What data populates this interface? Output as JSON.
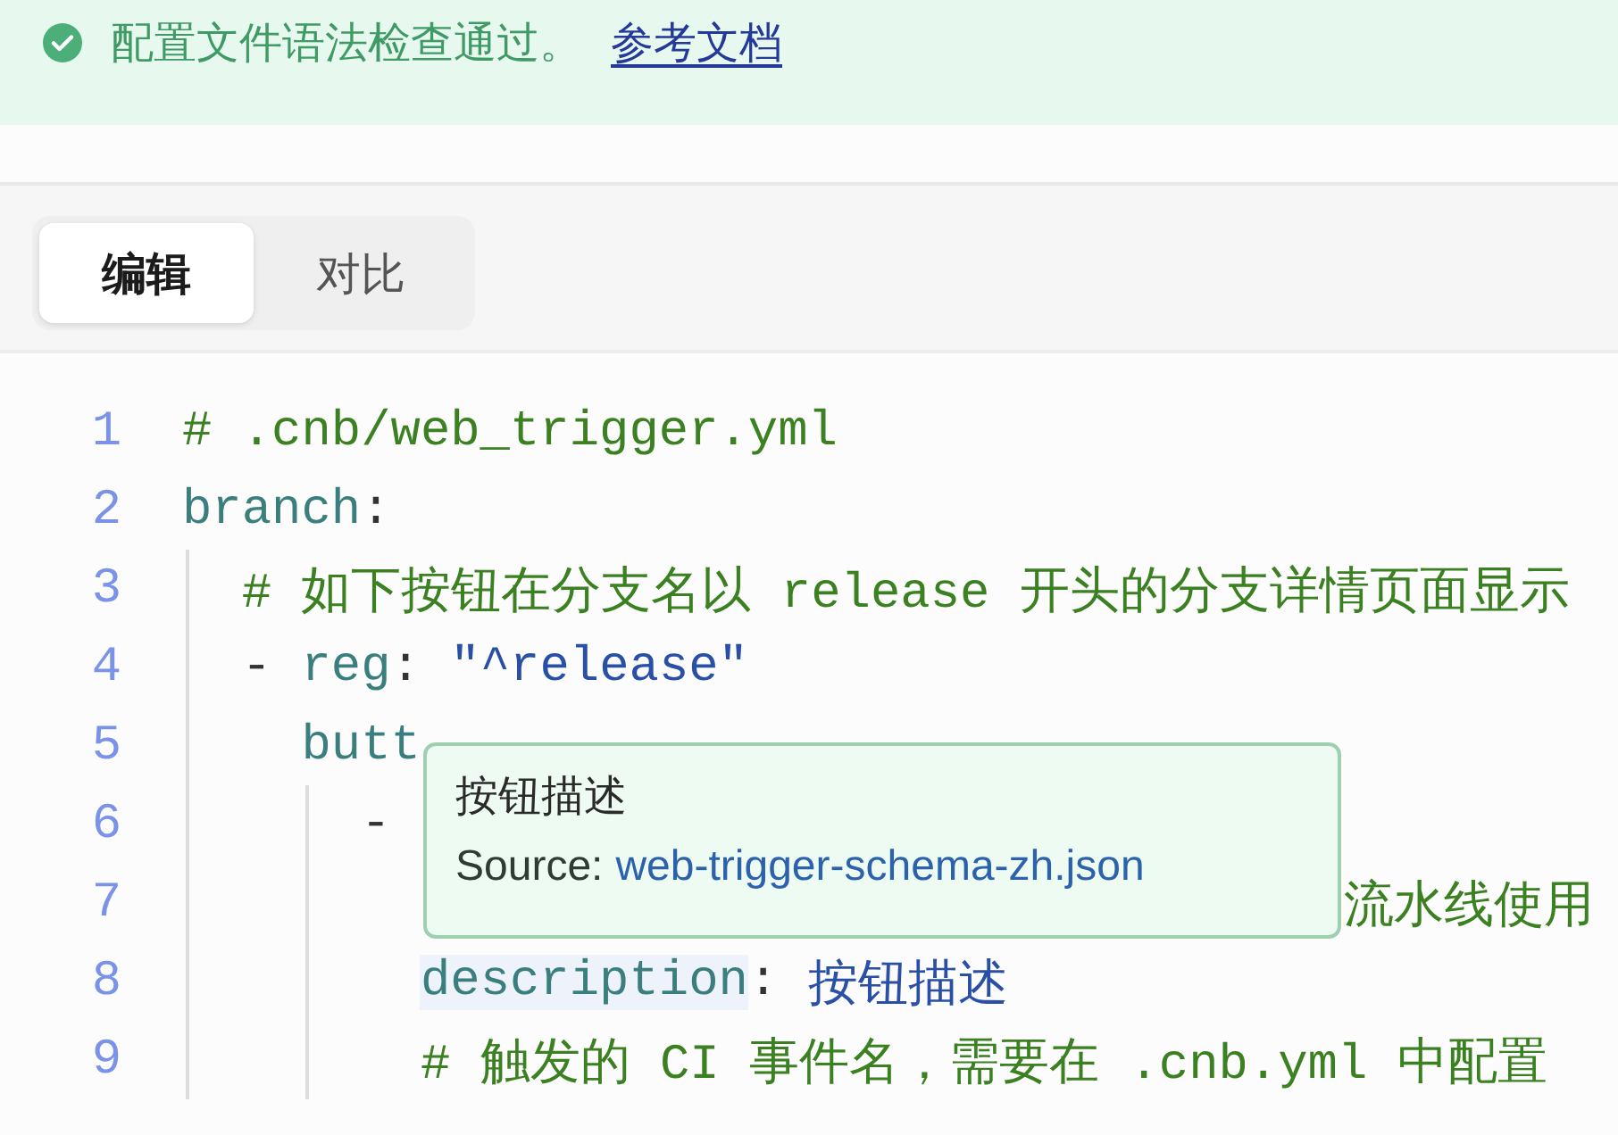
{
  "banner": {
    "message": "配置文件语法检查通过。",
    "link": "参考文档"
  },
  "tabs": [
    {
      "label": "编辑",
      "selected": true
    },
    {
      "label": "对比",
      "selected": false
    }
  ],
  "editor": {
    "lines": [
      {
        "number": "1",
        "tokens": [
          {
            "kind": "comment",
            "text": "# .cnb/web_trigger.yml"
          }
        ]
      },
      {
        "number": "2",
        "tokens": [
          {
            "kind": "key",
            "text": "branch"
          },
          {
            "kind": "punct",
            "text": ":"
          }
        ]
      },
      {
        "number": "3",
        "tokens": [
          {
            "kind": "comment",
            "text": "  # 如下按钮在分支名以 release 开头的分支详情页面显示"
          }
        ]
      },
      {
        "number": "4",
        "tokens": [
          {
            "kind": "punct",
            "text": "  - "
          },
          {
            "kind": "key",
            "text": "reg"
          },
          {
            "kind": "punct",
            "text": ": "
          },
          {
            "kind": "string",
            "text": "\"^release\""
          }
        ]
      },
      {
        "number": "5",
        "tokens": [
          {
            "kind": "key",
            "text": "    butt"
          }
        ]
      },
      {
        "number": "6",
        "tokens": [
          {
            "kind": "punct",
            "text": "      -"
          }
        ]
      },
      {
        "number": "7",
        "tokens": [
          {
            "kind": "comment",
            "text": "                                       流水线使用"
          }
        ]
      },
      {
        "number": "8",
        "tokens": [
          {
            "kind": "highlighted-key",
            "text": "        description"
          },
          {
            "kind": "punct",
            "text": ": "
          },
          {
            "kind": "string",
            "text": "按钮描述"
          }
        ]
      },
      {
        "number": "9",
        "tokens": [
          {
            "kind": "comment",
            "text": "        # 触发的 CI 事件名，需要在 .cnb.yml 中配置"
          }
        ]
      }
    ]
  },
  "tooltip": {
    "title": "按钮描述",
    "source_label": "Source:",
    "source_link": "web-trigger-schema-zh.json"
  }
}
